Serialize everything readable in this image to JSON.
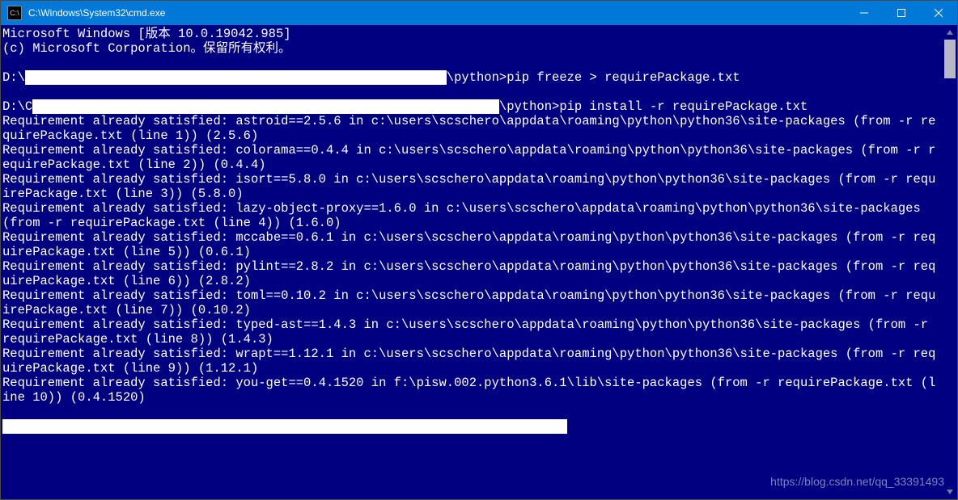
{
  "titlebar": {
    "icon_text": "C:\\",
    "title": "C:\\Windows\\System32\\cmd.exe"
  },
  "header": {
    "line1": "Microsoft Windows [版本 10.0.19042.985]",
    "line2": "(c) Microsoft Corporation。保留所有权利。"
  },
  "prompts": {
    "p1_prefix": "D:\\",
    "p1_suffix": "\\python>pip freeze > requirePackage.txt",
    "p2_prefix": "D:\\C",
    "p2_suffix": "\\python>pip install -r requirePackage.txt"
  },
  "redact": {
    "r1": "                                                        ",
    "r2": "                                                              ",
    "r3": "                                                                           "
  },
  "pkgs": {
    "astroid": "Requirement already satisfied: astroid==2.5.6 in c:\\users\\scschero\\appdata\\roaming\\python\\python36\\site-packages (from -r requirePackage.txt (line 1)) (2.5.6)",
    "colorama": "Requirement already satisfied: colorama==0.4.4 in c:\\users\\scschero\\appdata\\roaming\\python\\python36\\site-packages (from -r requirePackage.txt (line 2)) (0.4.4)",
    "isort": "Requirement already satisfied: isort==5.8.0 in c:\\users\\scschero\\appdata\\roaming\\python\\python36\\site-packages (from -r requirePackage.txt (line 3)) (5.8.0)",
    "lazy": "Requirement already satisfied: lazy-object-proxy==1.6.0 in c:\\users\\scschero\\appdata\\roaming\\python\\python36\\site-packages (from -r requirePackage.txt (line 4)) (1.6.0)",
    "mccabe": "Requirement already satisfied: mccabe==0.6.1 in c:\\users\\scschero\\appdata\\roaming\\python\\python36\\site-packages (from -r requirePackage.txt (line 5)) (0.6.1)",
    "pylint": "Requirement already satisfied: pylint==2.8.2 in c:\\users\\scschero\\appdata\\roaming\\python\\python36\\site-packages (from -r requirePackage.txt (line 6)) (2.8.2)",
    "toml": "Requirement already satisfied: toml==0.10.2 in c:\\users\\scschero\\appdata\\roaming\\python\\python36\\site-packages (from -r requirePackage.txt (line 7)) (0.10.2)",
    "typedast": "Requirement already satisfied: typed-ast==1.4.3 in c:\\users\\scschero\\appdata\\roaming\\python\\python36\\site-packages (from -r requirePackage.txt (line 8)) (1.4.3)",
    "wrapt": "Requirement already satisfied: wrapt==1.12.1 in c:\\users\\scschero\\appdata\\roaming\\python\\python36\\site-packages (from -r requirePackage.txt (line 9)) (1.12.1)",
    "youget": "Requirement already satisfied: you-get==0.4.1520 in f:\\pisw.002.python3.6.1\\lib\\site-packages (from -r requirePackage.txt (line 10)) (0.4.1520)"
  },
  "watermark": "https://blog.csdn.net/qq_33391493"
}
